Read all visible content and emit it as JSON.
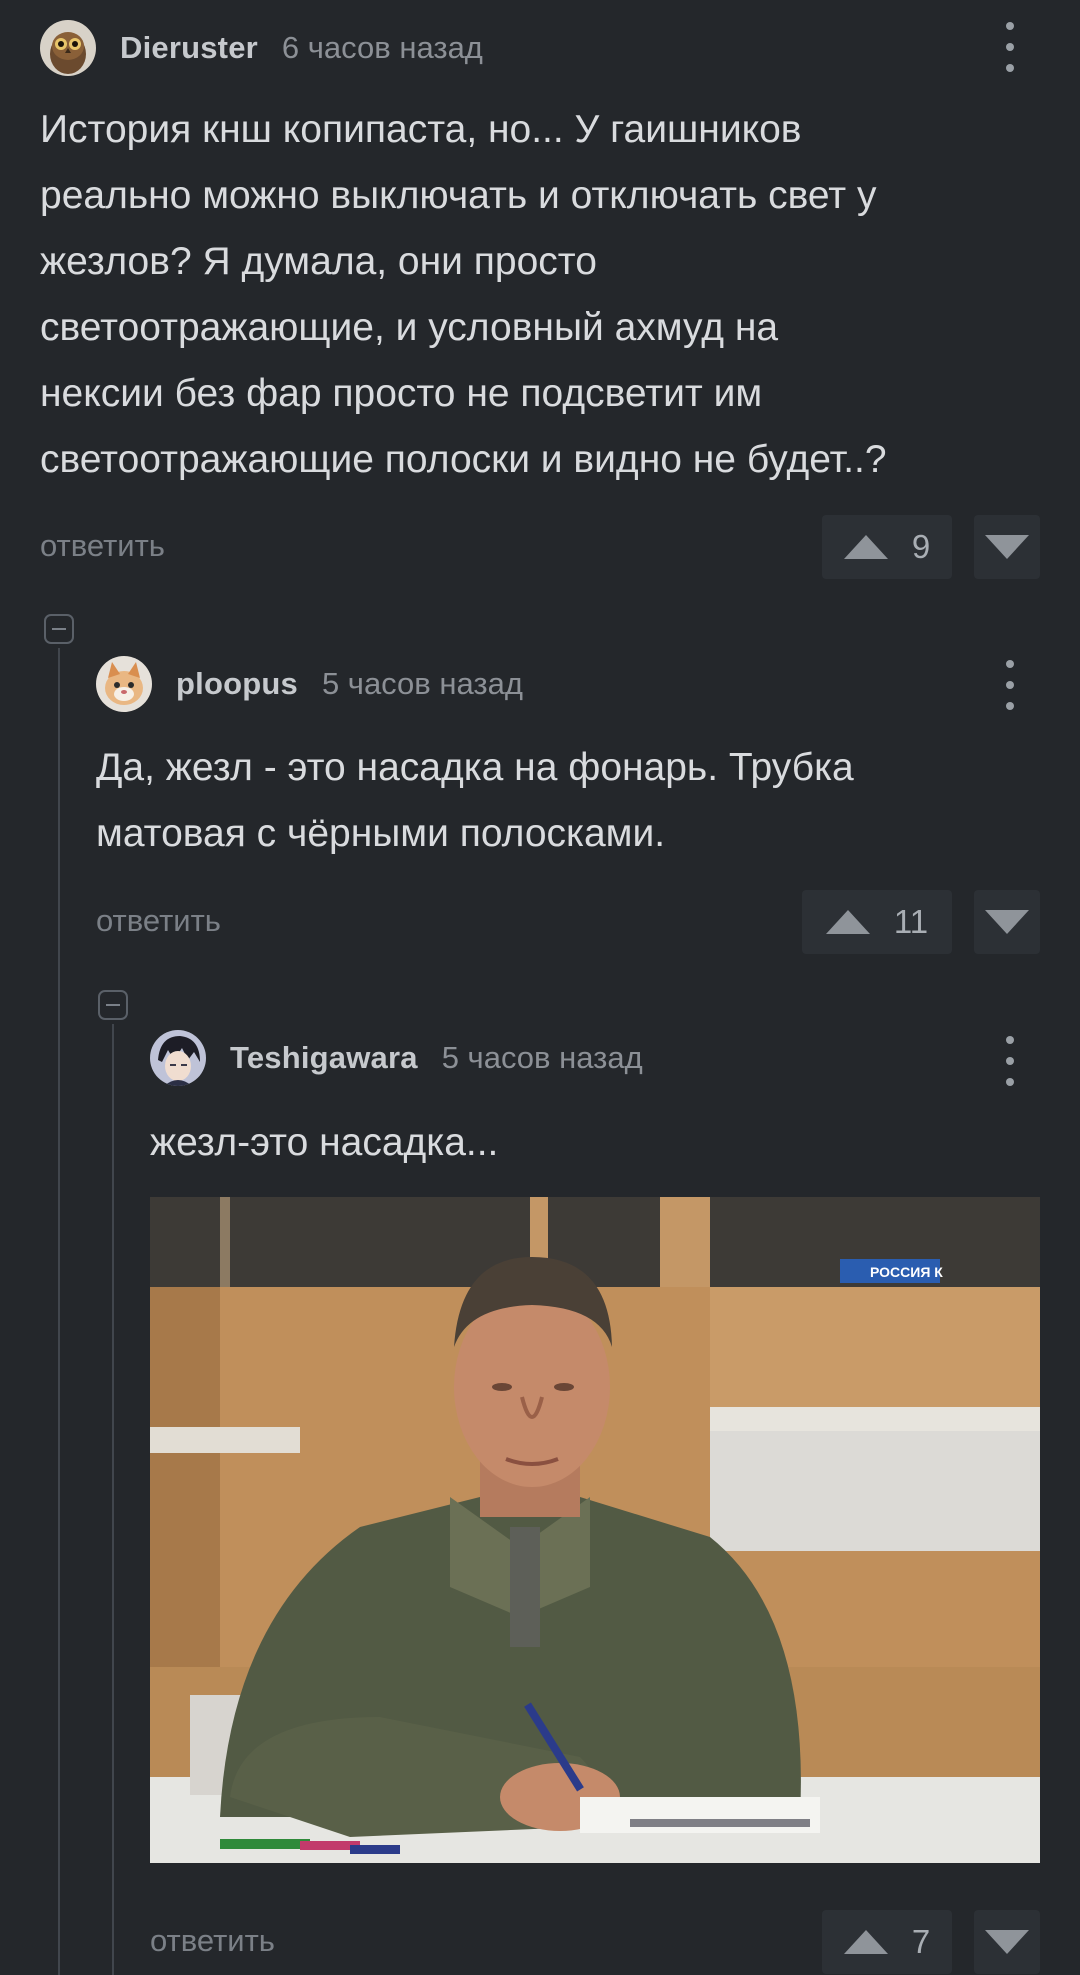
{
  "colors": {
    "background": "#24272b",
    "text": "#d9dbde",
    "muted": "#8c9096",
    "vote_box": "#2c3035"
  },
  "comments": [
    {
      "author": "Dieruster",
      "time": "6 часов назад",
      "text": "История кнш копипаста, но... У гаишников\nреально можно выключать и отключать свет у\nжезлов? Я думала, они просто\nсветоотражающие, и условный ахмуд на\nнексии без фар просто не подсветит им\nсветоотражающие полоски и видно не будет..?",
      "reply_label": "ответить",
      "votes": "9",
      "avatar_icon": "owl-avatar-icon"
    },
    {
      "author": "ploopus",
      "time": "5 часов назад",
      "text": "Да, жезл - это насадка на фонарь. Трубка\nматовая с чёрными полосками.",
      "reply_label": "ответить",
      "votes": "11",
      "avatar_icon": "cat-avatar-icon"
    },
    {
      "author": "Teshigawara",
      "time": "5 часов назад",
      "text": "жезл-это насадка...",
      "reply_label": "ответить",
      "votes": "7",
      "avatar_icon": "anime-avatar-icon",
      "image_watermark": "РОССИЯ К"
    }
  ]
}
